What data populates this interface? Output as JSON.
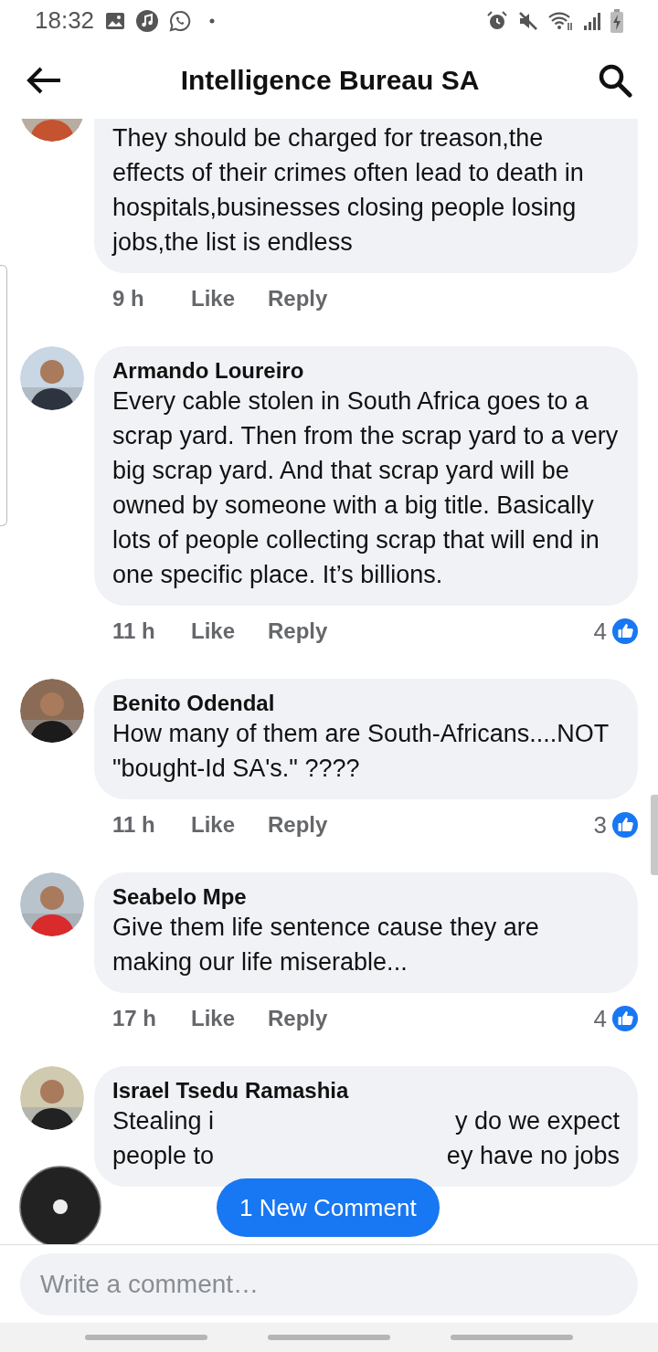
{
  "status_bar": {
    "time": "18:32"
  },
  "header": {
    "title": "Intelligence Bureau SA"
  },
  "comments": [
    {
      "kind": "cut_top",
      "text": "They should be charged for treason,the effects of their crimes often lead to death in hospitals,businesses closing people losing jobs,the list is endless",
      "time": "9 h",
      "like": "Like",
      "reply": "Reply"
    },
    {
      "kind": "full",
      "author": "Armando Loureiro",
      "text": "Every cable stolen in South Africa goes to a scrap yard.  Then from the scrap yard to a very big scrap yard.  And that scrap yard will be owned by someone with a big title.  Basically lots of people collecting scrap that will end in one specific place.  It’s billions.",
      "time": "11 h",
      "like": "Like",
      "reply": "Reply",
      "reactions": "4"
    },
    {
      "kind": "full",
      "author": "Benito Odendal",
      "text": "How many of them are South-Africans....NOT \"bought-Id SA's.\" ????",
      "time": "11 h",
      "like": "Like",
      "reply": "Reply",
      "reactions": "3"
    },
    {
      "kind": "full",
      "author": "Seabelo Mpe",
      "text": "Give them life sentence cause they are making our life miserable...",
      "time": "17 h",
      "like": "Like",
      "reply": "Reply",
      "reactions": "4"
    },
    {
      "kind": "covered",
      "author": "Israel Tsedu Ramashia",
      "lines": [
        [
          "Stealing i",
          "y do we expect"
        ],
        [
          "people to",
          "ey have no jobs"
        ]
      ]
    }
  ],
  "new_comments_button": "1 New Comment",
  "composer": {
    "placeholder": "Write a comment…"
  }
}
